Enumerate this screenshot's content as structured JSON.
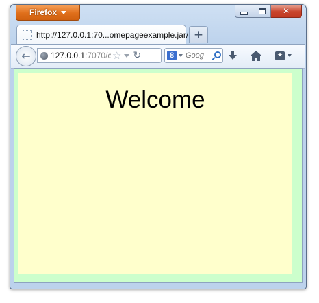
{
  "app_menu": {
    "label": "Firefox"
  },
  "tab": {
    "title": "http://127.0.0.1:70...omepageexample.jar/"
  },
  "newtab": {
    "label": "+"
  },
  "urlbar": {
    "host": "127.0.0.1",
    "rest": ":7070/c"
  },
  "searchbar": {
    "engine_badge": "8",
    "placeholder": "Goog"
  },
  "page": {
    "heading": "Welcome",
    "outer_bg": "#ccffcc",
    "inner_bg": "#ffffcc"
  },
  "colors": {
    "app_button": "#e0701c",
    "close_button": "#c9452c",
    "search_icon": "#2f6fc4"
  },
  "icons": {
    "minimize": "minimize-icon",
    "maximize": "maximize-icon",
    "close": "close-icon",
    "back": "back-arrow-icon",
    "site": "globe-icon",
    "bookmark_star": "star-icon",
    "reload": "reload-icon",
    "search": "search-icon",
    "downloads": "download-arrow-icon",
    "home": "home-icon",
    "bookmarks": "bookmarks-icon"
  }
}
